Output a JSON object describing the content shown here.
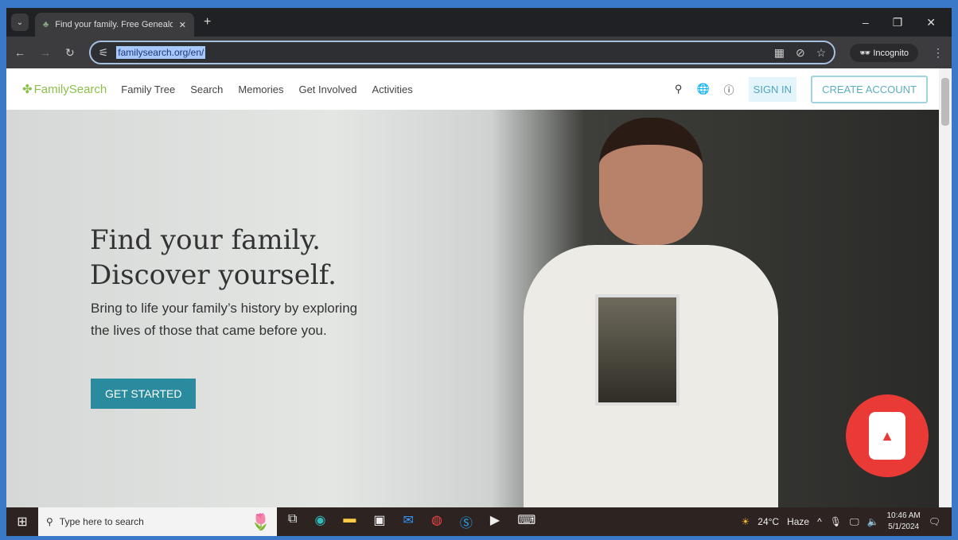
{
  "browser": {
    "tab_title": "Find your family. Free Genealog",
    "url": "familysearch.org/en/",
    "incognito_label": "Incognito"
  },
  "nav": {
    "logo": "FamilySearch",
    "items": [
      "Family Tree",
      "Search",
      "Memories",
      "Get Involved",
      "Activities"
    ],
    "sign_in": "SIGN IN",
    "create_account": "CREATE ACCOUNT"
  },
  "hero": {
    "title_line1": "Find your family.",
    "title_line2": "Discover yourself.",
    "subtitle": "Bring to life your family’s history by exploring the lives of those that came before you.",
    "cta": "GET STARTED"
  },
  "taskbar": {
    "search_placeholder": "Type here to search",
    "weather_temp": "24°C",
    "weather_desc": "Haze",
    "time": "10:46 AM",
    "date": "5/1/2024"
  },
  "colors": {
    "brand_green": "#8cc04b",
    "cta_teal": "#2a8a9e",
    "record_red": "#e93a36"
  }
}
